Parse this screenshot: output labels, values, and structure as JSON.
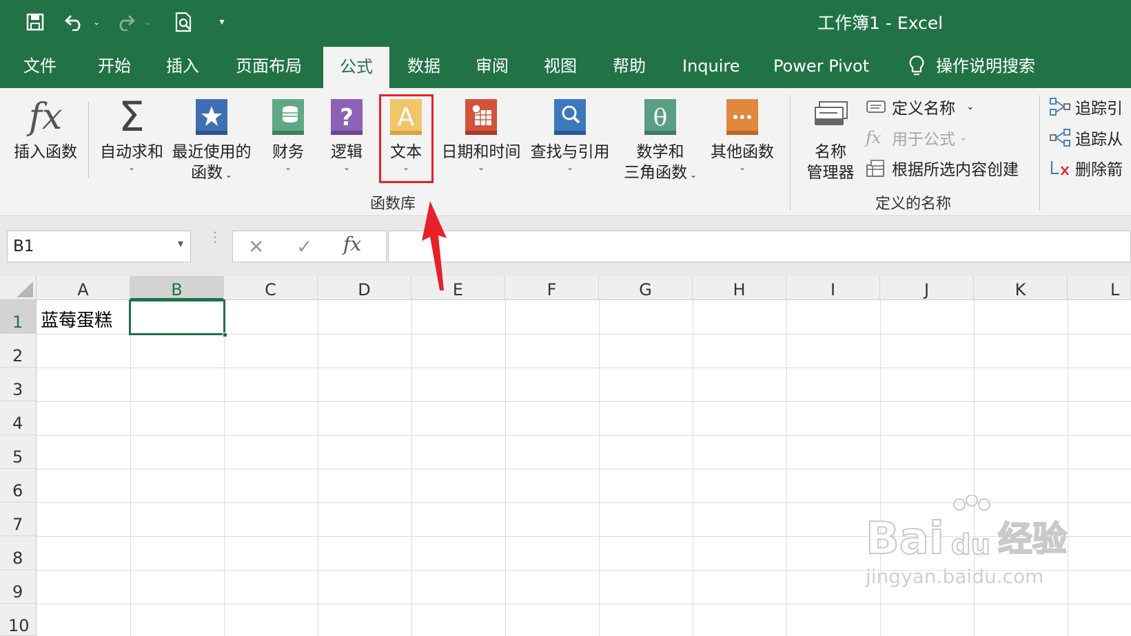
{
  "window": {
    "title": "工作簿1  -  Excel"
  },
  "qat": {
    "icons": [
      "save-icon",
      "undo-icon",
      "redo-icon",
      "print-preview-icon",
      "customize-qat-icon"
    ]
  },
  "tabs": [
    {
      "label": "文件",
      "active": false
    },
    {
      "label": "开始",
      "active": false
    },
    {
      "label": "插入",
      "active": false
    },
    {
      "label": "页面布局",
      "active": false
    },
    {
      "label": "公式",
      "active": true
    },
    {
      "label": "数据",
      "active": false
    },
    {
      "label": "审阅",
      "active": false
    },
    {
      "label": "视图",
      "active": false
    },
    {
      "label": "帮助",
      "active": false
    },
    {
      "label": "Inquire",
      "active": false
    },
    {
      "label": "Power Pivot",
      "active": false
    }
  ],
  "search": {
    "label": "操作说明搜索",
    "icon": "lightbulb-icon"
  },
  "ribbon": {
    "insert_function": "插入函数",
    "autosum": "自动求和",
    "recent_line1": "最近使用的",
    "recent_line2": "函数",
    "financial": "财务",
    "logical": "逻辑",
    "text": "文本",
    "datetime": "日期和时间",
    "lookup": "查找与引用",
    "math_line1": "数学和",
    "math_line2": "三角函数",
    "more": "其他函数",
    "group_function_library": "函数库",
    "name_manager_line1": "名称",
    "name_manager_line2": "管理器",
    "define_name": "定义名称",
    "use_in_formula": "用于公式",
    "create_from_selection": "根据所选内容创建",
    "group_defined_names": "定义的名称",
    "trace_precedents": "追踪引",
    "trace_dependents": "追踪从",
    "remove_arrows": "删除箭",
    "colors": {
      "accent": "#217346",
      "financial": "#5fa883",
      "logical": "#8b62b5",
      "text": "#f1c56a",
      "datetime": "#d2533a",
      "lookup": "#3b78bd",
      "math": "#5a9e84",
      "more": "#e0883d",
      "highlight": "#e8202a"
    }
  },
  "formula_bar": {
    "name_box": "B1",
    "formula": ""
  },
  "sheet": {
    "columns": [
      "A",
      "B",
      "C",
      "D",
      "E",
      "F",
      "G",
      "H",
      "I",
      "J",
      "K",
      "L"
    ],
    "rows": [
      "1",
      "2",
      "3",
      "4",
      "5",
      "6",
      "7",
      "8",
      "9",
      "10"
    ],
    "selected_cell": "B1",
    "cells": {
      "A1": "蓝莓蛋糕"
    }
  },
  "watermark": {
    "brand": "Bai",
    "brand_du": "du",
    "brand_cn": "经验",
    "url": "jingyan.baidu.com"
  }
}
